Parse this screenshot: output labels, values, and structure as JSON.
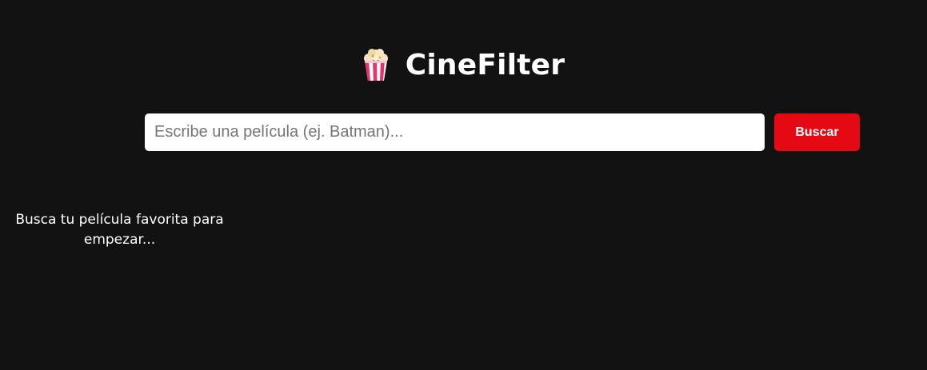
{
  "header": {
    "logo_icon": "popcorn-icon",
    "title": "CineFilter"
  },
  "search": {
    "placeholder": "Escribe una película (ej. Batman)...",
    "value": "",
    "button_label": "Buscar"
  },
  "results": {
    "empty_message": "Busca tu película favorita para empezar..."
  },
  "colors": {
    "background": "#121212",
    "accent": "#e50914",
    "text": "#ffffff"
  }
}
